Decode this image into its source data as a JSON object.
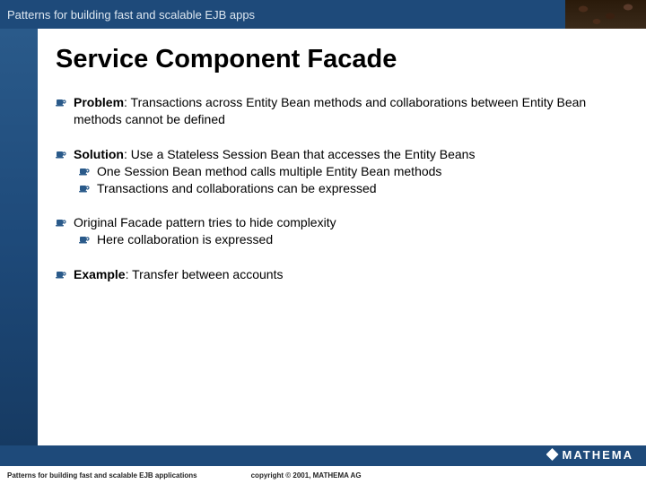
{
  "header": {
    "title": "Patterns for building fast and scalable EJB apps"
  },
  "slide": {
    "title": "Service Component Facade",
    "bullets": [
      {
        "label": "Problem",
        "text": ": Transactions across Entity Bean methods and collaborations between Entity Bean methods cannot be defined",
        "subs": []
      },
      {
        "label": "Solution",
        "text": ": Use a Stateless Session Bean that accesses the Entity Beans",
        "subs": [
          {
            "text": "One Session Bean method calls multiple Entity Bean methods"
          },
          {
            "text": "Transactions and collaborations can be expressed"
          }
        ]
      },
      {
        "label": "",
        "text": "Original Facade pattern tries to hide complexity",
        "subs": [
          {
            "text": "Here collaboration is expressed"
          }
        ]
      },
      {
        "label": "Example",
        "text": ": Transfer between accounts",
        "subs": []
      }
    ]
  },
  "footer": {
    "logo": "MATHEMA",
    "left": "Patterns for building fast and scalable EJB applications",
    "copyright": "copyright © 2001, MATHEMA AG"
  }
}
